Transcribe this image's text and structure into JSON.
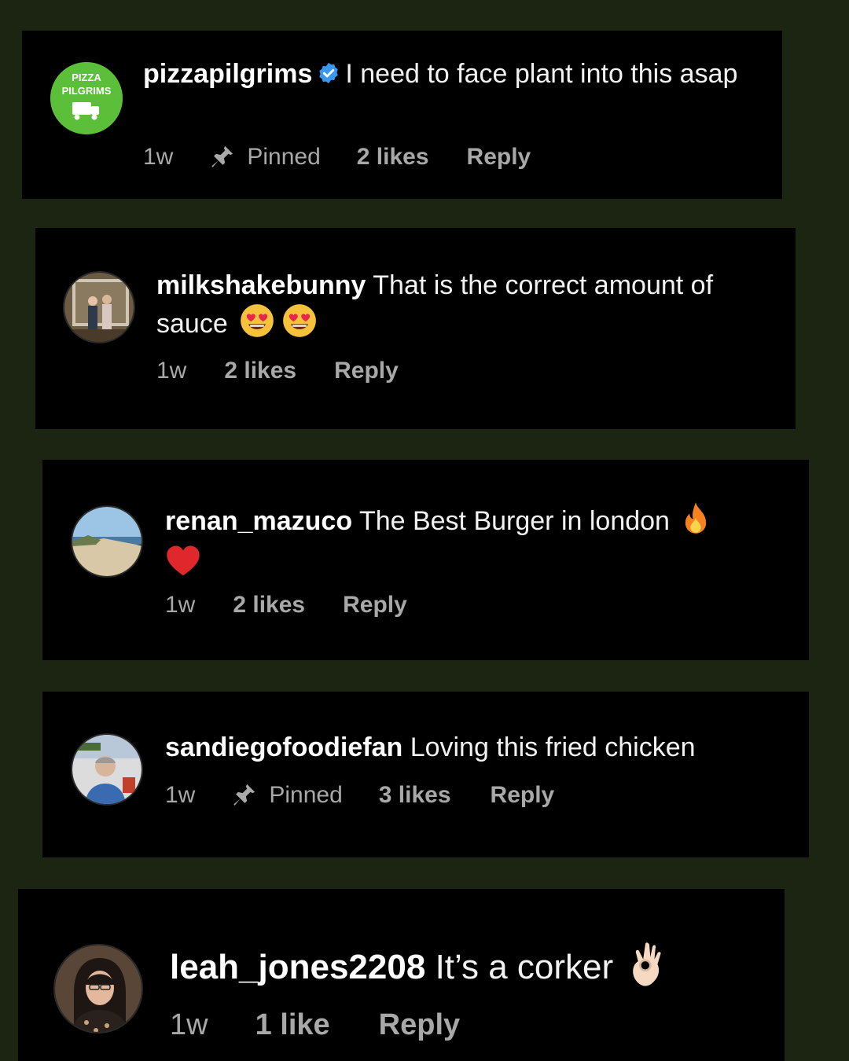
{
  "colors": {
    "page_background": "#1c2412",
    "card_background": "#000000",
    "verified": "#3897f0",
    "brand_green": "#5cbf3a"
  },
  "comments": [
    {
      "username": "pizzapilgrims",
      "verified": true,
      "avatar": {
        "type": "logo",
        "line1": "PIZZA",
        "line2": "PILGRIMS"
      },
      "text": "I need to face plant into this asap",
      "emojis": [],
      "time": "1w",
      "pinned_label": "Pinned",
      "likes": "2 likes",
      "reply": "Reply"
    },
    {
      "username": "milkshakebunny",
      "verified": false,
      "avatar": {
        "type": "photo",
        "icon": "couple-photo"
      },
      "text": "That is the correct amount of sauce",
      "emojis": [
        "heart-eyes-emoji",
        "heart-eyes-emoji"
      ],
      "time": "1w",
      "likes": "2 likes",
      "reply": "Reply"
    },
    {
      "username": "renan_mazuco",
      "verified": false,
      "avatar": {
        "type": "photo",
        "icon": "beach-photo"
      },
      "text": "The Best Burger in london",
      "emojis": [
        "fire-emoji",
        "red-heart-emoji"
      ],
      "time": "1w",
      "likes": "2 likes",
      "reply": "Reply"
    },
    {
      "username": "sandiegofoodiefan",
      "verified": false,
      "avatar": {
        "type": "photo",
        "icon": "man-photo"
      },
      "text": "Loving this fried chicken",
      "emojis": [],
      "time": "1w",
      "pinned_label": "Pinned",
      "likes": "3 likes",
      "reply": "Reply"
    },
    {
      "username": "leah_jones2208",
      "verified": false,
      "avatar": {
        "type": "photo",
        "icon": "woman-photo"
      },
      "text": "It’s a corker",
      "emojis": [
        "ok-hand-emoji"
      ],
      "time": "1w",
      "likes": "1 like",
      "reply": "Reply"
    }
  ]
}
